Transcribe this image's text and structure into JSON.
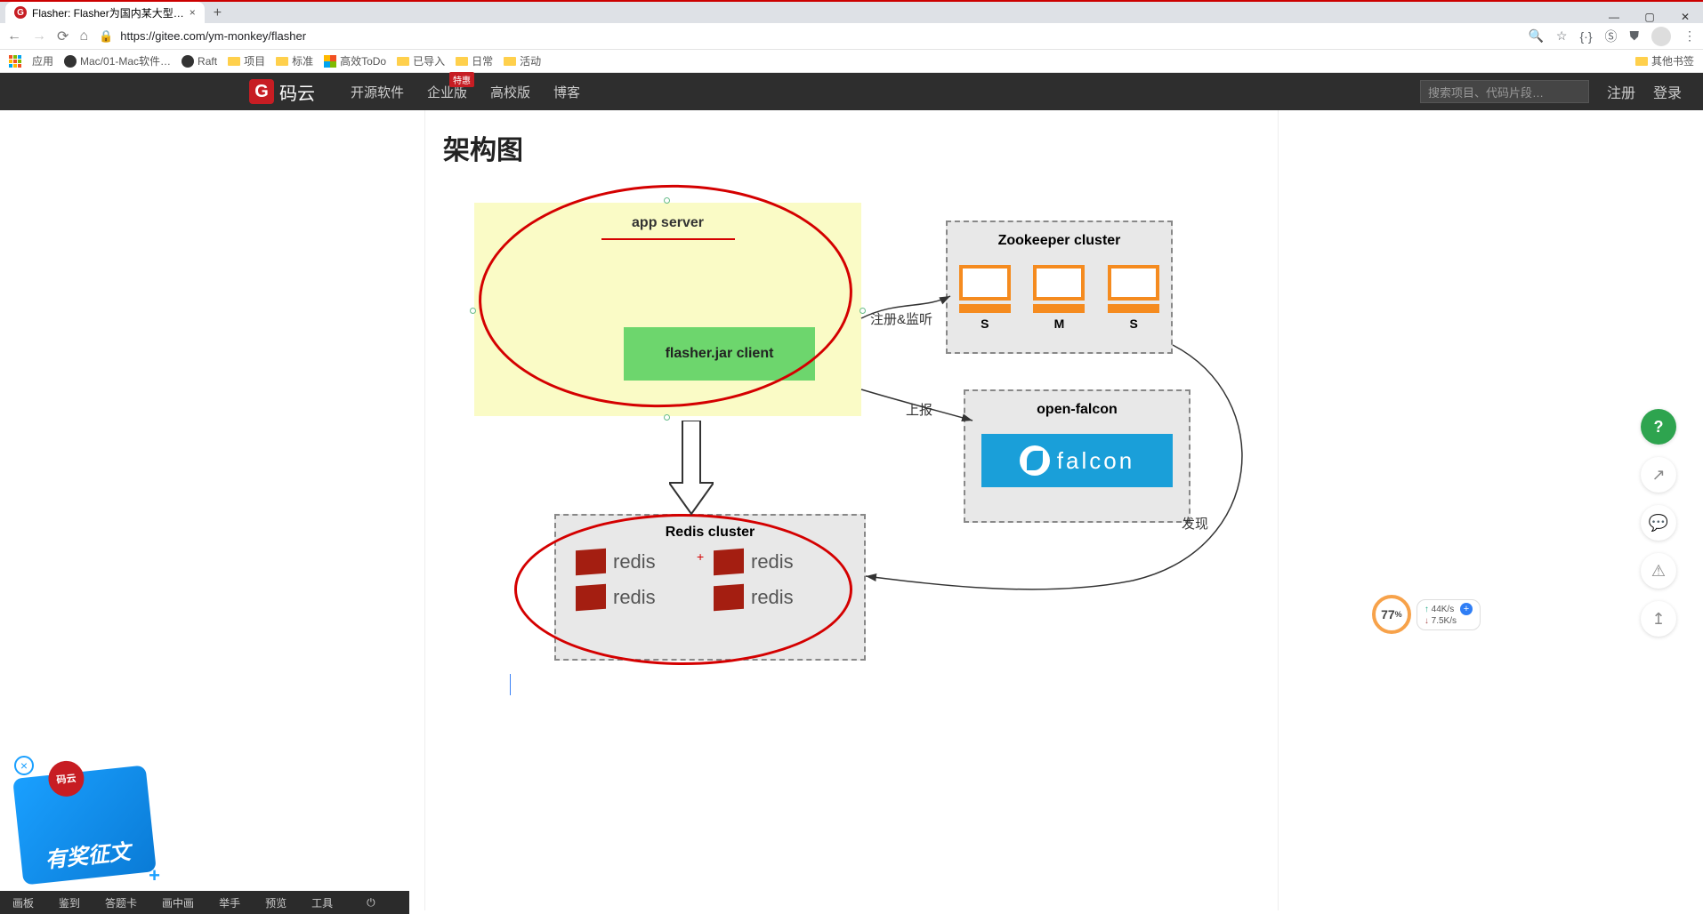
{
  "browser": {
    "tab_title": "Flasher: Flasher为国内某大型…",
    "url": "https://gitee.com/ym-monkey/flasher",
    "bookmarks": [
      "应用",
      "Mac/01-Mac软件…",
      "Raft",
      "项目",
      "标准",
      "高效ToDo",
      "已导入",
      "日常",
      "活动"
    ],
    "other_bookmarks": "其他书签"
  },
  "gitee": {
    "brand": "码云",
    "nav": {
      "opensrc": "开源软件",
      "ent": "企业版",
      "ent_badge": "特惠",
      "edu": "高校版",
      "blog": "博客"
    },
    "search_placeholder": "搜索项目、代码片段…",
    "register": "注册",
    "login": "登录"
  },
  "page_title": "架构图",
  "diagram": {
    "app_box_title": "app server",
    "jar_client": "flasher.jar client",
    "zk_title": "Zookeeper cluster",
    "zk_nodes": [
      "S",
      "M",
      "S"
    ],
    "of_title": "open-falcon",
    "of_logo": "falcon",
    "redis_title": "Redis cluster",
    "redis_label": "redis",
    "edge_register": "注册&监听",
    "edge_report": "上报",
    "edge_discover": "发现"
  },
  "promo": {
    "pill": "码云",
    "text": "有奖征文"
  },
  "net": {
    "pct": "77",
    "pct_suffix": "%",
    "up": "44K/s",
    "down": "7.5K/s"
  },
  "toolbar": [
    "画板",
    "鉴到",
    "答题卡",
    "画中画",
    "举手",
    "预览",
    "工具"
  ],
  "help": "?"
}
